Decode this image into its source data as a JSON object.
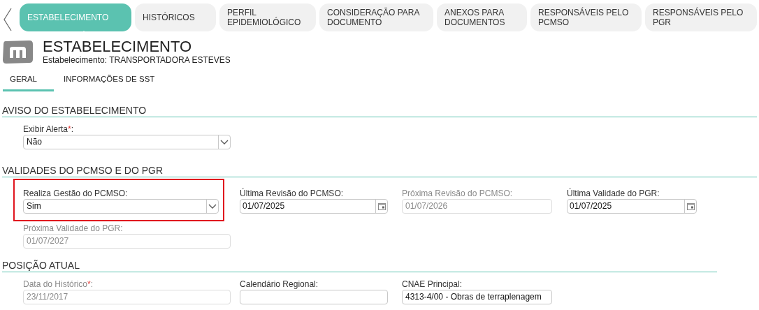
{
  "tabs": [
    {
      "label": "ESTABELECIMENTO",
      "selected": true
    },
    {
      "label": "HISTÓRICOS",
      "selected": false
    },
    {
      "label": "PERFIL EPIDEMIOLÓGICO",
      "selected": false
    },
    {
      "label": "CONSIDERAÇÃO PARA DOCUMENTO",
      "selected": false
    },
    {
      "label": "ANEXOS PARA DOCUMENTOS",
      "selected": false
    },
    {
      "label": "RESPONSÁVEIS PELO PCMSO",
      "selected": false
    },
    {
      "label": "RESPONSÁVEIS PELO PGR",
      "selected": false
    }
  ],
  "header": {
    "title": "ESTABELECIMENTO",
    "subtitle": "Estabelecimento: TRANSPORTADORA ESTEVES"
  },
  "subtabs": [
    {
      "label": "GERAL",
      "selected": true
    },
    {
      "label": "INFORMAÇÕES DE SST",
      "selected": false
    }
  ],
  "sections": [
    {
      "title": "AVISO DO ESTABELECIMENTO",
      "rows": [
        [
          {
            "label": "Exibir Alerta",
            "required": true,
            "marker": "*",
            "colon": ":",
            "kind": "select",
            "value": "Não",
            "disabled": false,
            "highlighted": false
          }
        ]
      ]
    },
    {
      "title": "VALIDADES DO PCMSO E DO PGR",
      "rows": [
        [
          {
            "label": "Realiza Gestão do PCMSO:",
            "required": false,
            "kind": "select",
            "value": "Sim",
            "disabled": false,
            "highlighted": true
          },
          {
            "label": "Última Revisão do PCMSO:",
            "required": false,
            "kind": "date",
            "value": "01/07/2025",
            "disabled": false,
            "highlighted": false
          },
          {
            "label": "Próxima Revisão do PCMSO:",
            "required": false,
            "kind": "text",
            "value": "01/07/2026",
            "disabled": true,
            "highlighted": false
          },
          {
            "label": "Última Validade do PGR:",
            "required": false,
            "kind": "date",
            "value": "01/07/2025",
            "disabled": false,
            "highlighted": false
          }
        ],
        [
          {
            "label": "Próxima Validade do PGR:",
            "required": false,
            "kind": "text",
            "value": "01/07/2027",
            "disabled": true,
            "highlighted": false
          }
        ]
      ]
    },
    {
      "title": "POSIÇÃO ATUAL",
      "rows": [
        [
          {
            "label": "Data do Histórico",
            "required": true,
            "marker": "*",
            "colon": ":",
            "kind": "text",
            "value": "23/11/2017",
            "disabled": true,
            "highlighted": false
          },
          {
            "label": "Calendário Regional:",
            "required": false,
            "kind": "text",
            "disabled": false,
            "highlighted": false
          },
          {
            "label": "CNAE Principal:",
            "required": false,
            "kind": "text",
            "value": "4313-4/00 - Obras de terraplenagem",
            "disabled": false,
            "highlighted": false
          }
        ]
      ]
    }
  ]
}
